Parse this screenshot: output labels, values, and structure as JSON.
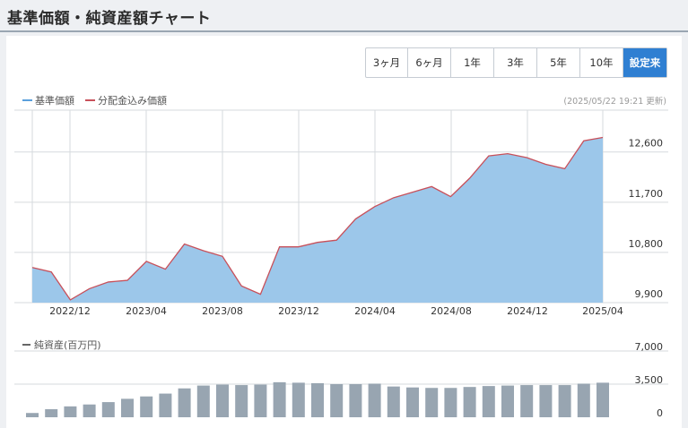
{
  "header": {
    "title": "基準価額・純資産額チャート"
  },
  "range_buttons": [
    {
      "label": "3ヶ月",
      "active": false
    },
    {
      "label": "6ヶ月",
      "active": false
    },
    {
      "label": "1年",
      "active": false
    },
    {
      "label": "3年",
      "active": false
    },
    {
      "label": "5年",
      "active": false
    },
    {
      "label": "10年",
      "active": false
    },
    {
      "label": "設定来",
      "active": true
    }
  ],
  "legend": {
    "nav_label": "基準価額",
    "dist_label": "分配金込み価額"
  },
  "updated_text": "(2025/05/22 19:21 更新)",
  "bar_legend_label": "純資産(百万円)",
  "colors": {
    "nav_fill": "#9cc7ea",
    "nav_legend": "#5aa0dc",
    "dist_line": "#c8505a",
    "bars": "#98a5b1",
    "active_button": "#2f7fd2"
  },
  "chart_data": [
    {
      "type": "area",
      "series": [
        {
          "name": "基準価額",
          "values": [
            10530,
            10450,
            9950,
            10150,
            10270,
            10300,
            10640,
            10500,
            10950,
            10830,
            10730,
            10200,
            10050,
            10900,
            10900,
            10980,
            11020,
            11400,
            11620,
            11780,
            11880,
            11980,
            11800,
            12130,
            12530,
            12570,
            12500,
            12380,
            12300,
            12800,
            12860
          ]
        },
        {
          "name": "分配金込み価額",
          "values": [
            10530,
            10450,
            9950,
            10150,
            10270,
            10300,
            10640,
            10500,
            10950,
            10830,
            10730,
            10200,
            10050,
            10900,
            10900,
            10980,
            11020,
            11400,
            11620,
            11780,
            11880,
            11980,
            11800,
            12130,
            12530,
            12570,
            12500,
            12380,
            12300,
            12800,
            12860
          ]
        }
      ],
      "x_tick_labels": [
        "2022/12",
        "2023/04",
        "2023/08",
        "2023/12",
        "2024/04",
        "2024/08",
        "2024/12",
        "2025/04"
      ],
      "y_ticks": [
        9900,
        10800,
        11700,
        12600
      ],
      "y_tick_labels": [
        "9,900",
        "10,800",
        "11,700",
        "12,600"
      ],
      "ylim": [
        9900,
        13350
      ],
      "grid": true
    },
    {
      "type": "bar",
      "series": [
        {
          "name": "純資産(百万円)",
          "values": [
            450,
            850,
            1150,
            1350,
            1600,
            1950,
            2200,
            2500,
            3050,
            3350,
            3450,
            3400,
            3450,
            3700,
            3650,
            3600,
            3500,
            3500,
            3550,
            3250,
            3150,
            3100,
            3100,
            3200,
            3300,
            3350,
            3400,
            3400,
            3400,
            3550,
            3650
          ]
        }
      ],
      "y_ticks": [
        0,
        3500,
        7000
      ],
      "y_tick_labels": [
        "0",
        "3,500",
        "7,000"
      ],
      "ylim": [
        0,
        7000
      ]
    }
  ]
}
